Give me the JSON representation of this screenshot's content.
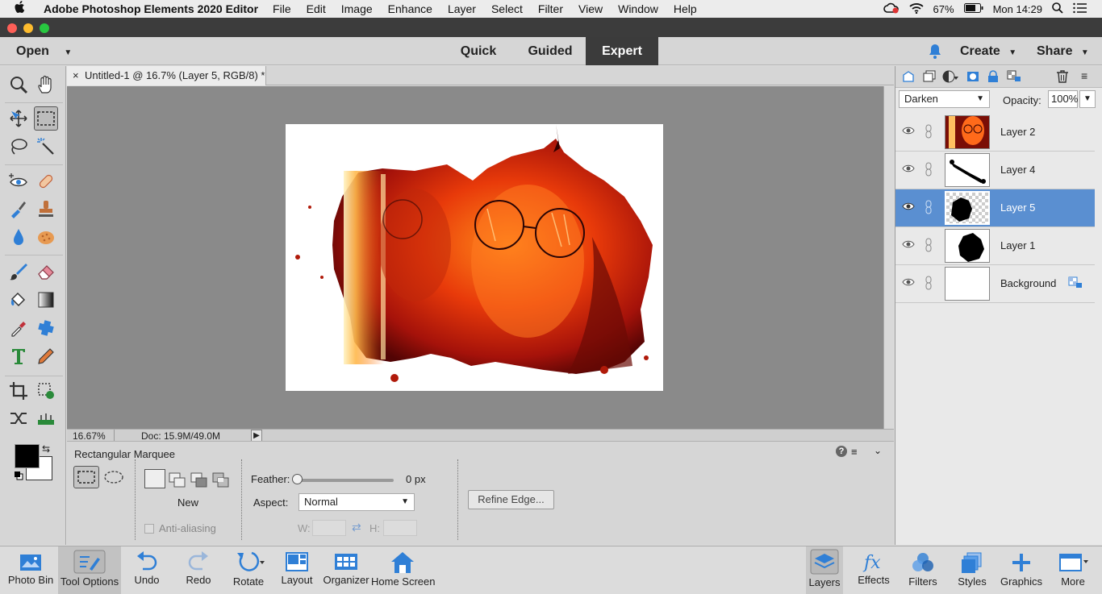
{
  "menubar": {
    "app_name": "Adobe Photoshop Elements 2020 Editor",
    "items": [
      "File",
      "Edit",
      "Image",
      "Enhance",
      "Layer",
      "Select",
      "Filter",
      "View",
      "Window",
      "Help"
    ],
    "battery": "67%",
    "clock": "Mon 14:29"
  },
  "modebar": {
    "open_label": "Open",
    "modes": [
      "Quick",
      "Guided",
      "Expert"
    ],
    "active_mode": "Expert",
    "create_label": "Create",
    "share_label": "Share"
  },
  "document": {
    "tab_title": "Untitled-1 @ 16.7% (Layer 5, RGB/8) *",
    "close_glyph": "×",
    "zoom": "16.67%",
    "doc_size": "Doc: 15.9M/49.0M"
  },
  "tool_options": {
    "tool_name": "Rectangular Marquee",
    "mode_label": "New",
    "anti_aliasing_label": "Anti-aliasing",
    "feather_label": "Feather:",
    "feather_value": "0 px",
    "feather_fraction": 0,
    "aspect_label": "Aspect:",
    "aspect_value": "Normal",
    "w_label": "W:",
    "h_label": "H:",
    "refine_edge_label": "Refine Edge..."
  },
  "layers_panel": {
    "blend_mode": "Darken",
    "opacity_label": "Opacity:",
    "opacity_value": "100%",
    "layers": [
      {
        "name": "Layer 2",
        "thumb": "photo"
      },
      {
        "name": "Layer 4",
        "thumb": "brush"
      },
      {
        "name": "Layer 5",
        "thumb": "splat-transparent",
        "selected": true
      },
      {
        "name": "Layer 1",
        "thumb": "splat"
      },
      {
        "name": "Background",
        "thumb": "white",
        "locked": true
      }
    ]
  },
  "taskbar": {
    "left": [
      "Photo Bin",
      "Tool Options",
      "Undo",
      "Redo",
      "Rotate",
      "Layout",
      "Organizer",
      "Home Screen"
    ],
    "right": [
      "Layers",
      "Effects",
      "Filters",
      "Styles",
      "Graphics",
      "More"
    ]
  },
  "colors": {
    "accent_blue": "#5a8fd1",
    "icon_blue": "#2f7fd6",
    "titlebar": "#3c3c3c"
  }
}
